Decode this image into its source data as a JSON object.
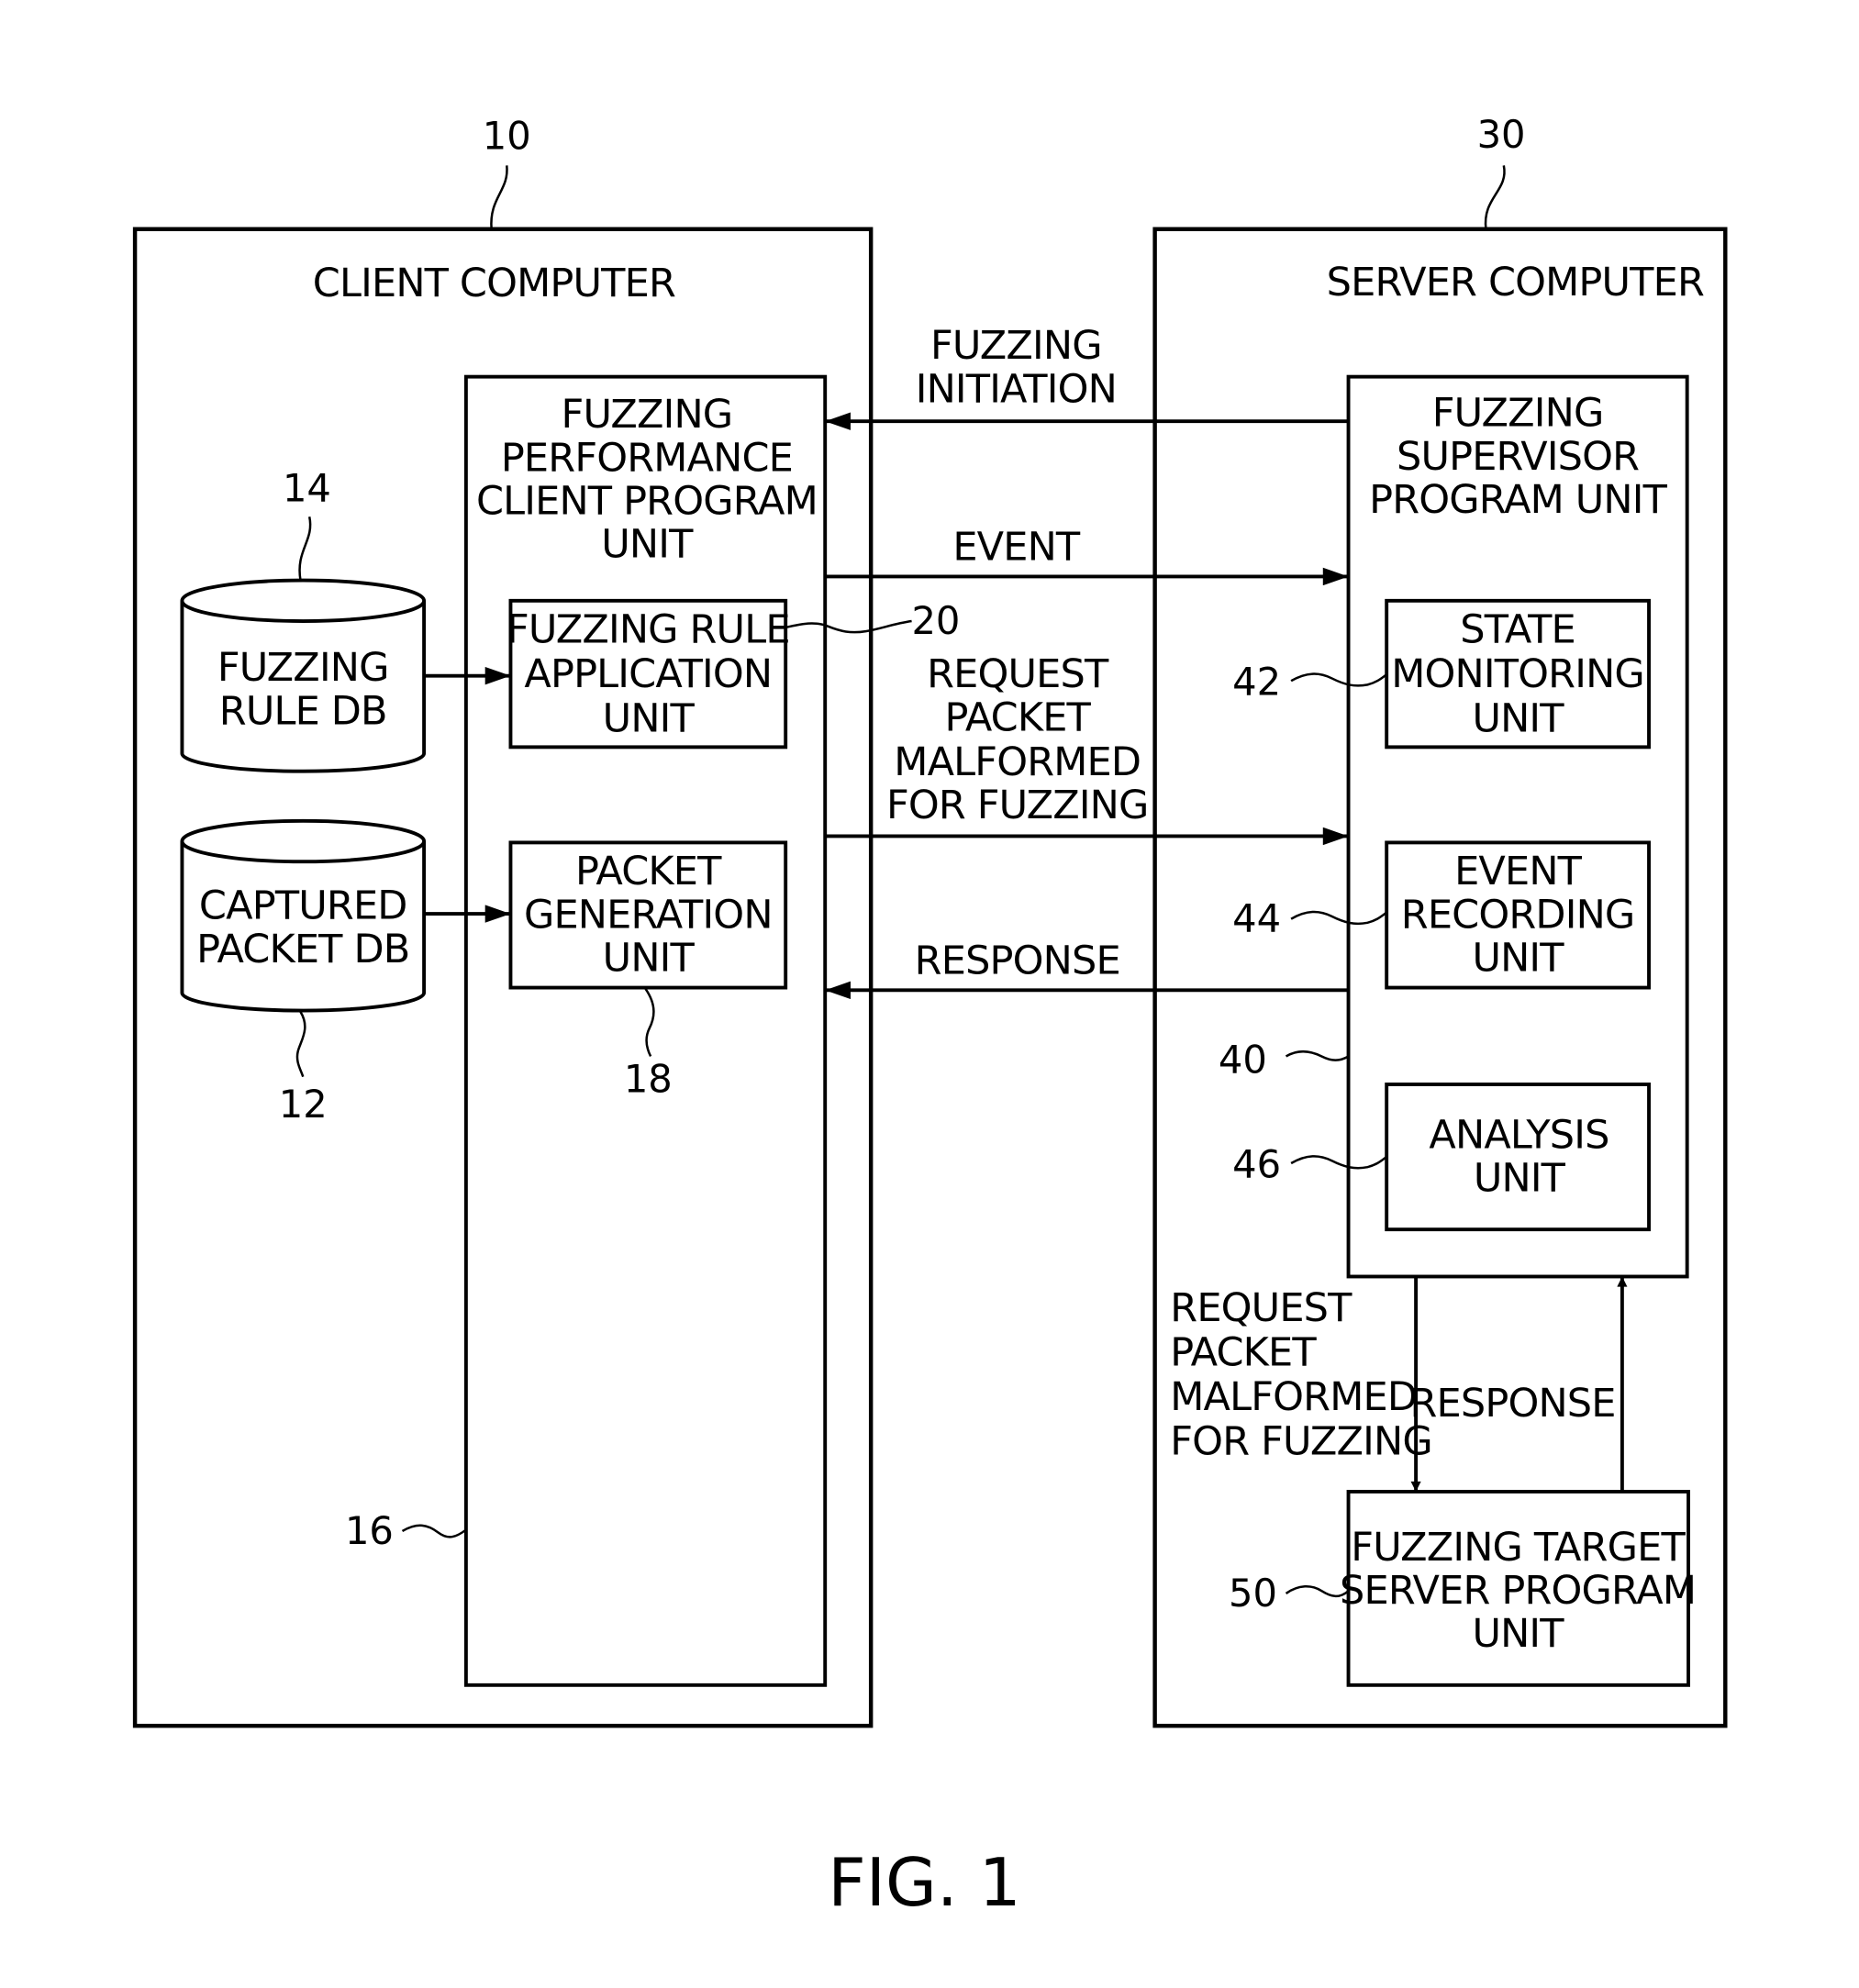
{
  "figure": {
    "caption": "FIG. 1",
    "client": {
      "ref": "10",
      "title": "CLIENT COMPUTER",
      "program_unit": {
        "ref": "16",
        "lines": [
          "FUZZING",
          "PERFORMANCE",
          "CLIENT PROGRAM",
          "UNIT"
        ]
      },
      "rule_application_unit": {
        "ref": "20",
        "lines": [
          "FUZZING RULE",
          "APPLICATION",
          "UNIT"
        ]
      },
      "packet_generation_unit": {
        "ref": "18",
        "lines": [
          "PACKET",
          "GENERATION",
          "UNIT"
        ]
      },
      "fuzzing_rule_db": {
        "ref": "14",
        "lines": [
          "FUZZING",
          "RULE DB"
        ]
      },
      "captured_packet_db": {
        "ref": "12",
        "lines": [
          "CAPTURED",
          "PACKET DB"
        ]
      }
    },
    "server": {
      "ref": "30",
      "title": "SERVER COMPUTER",
      "supervisor_unit": {
        "ref": "40",
        "lines": [
          "FUZZING",
          "SUPERVISOR",
          "PROGRAM UNIT"
        ]
      },
      "state_monitoring_unit": {
        "ref": "42",
        "lines": [
          "STATE",
          "MONITORING",
          "UNIT"
        ]
      },
      "event_recording_unit": {
        "ref": "44",
        "lines": [
          "EVENT",
          "RECORDING",
          "UNIT"
        ]
      },
      "analysis_unit": {
        "ref": "46",
        "lines": [
          "ANALYSIS",
          "UNIT"
        ]
      },
      "target_server_unit": {
        "ref": "50",
        "lines": [
          "FUZZING TARGET",
          "SERVER PROGRAM",
          "UNIT"
        ]
      }
    },
    "arrows": {
      "initiation": {
        "lines": [
          "FUZZING",
          "INITIATION"
        ],
        "direction": "server-to-client"
      },
      "event": {
        "lines": [
          "EVENT"
        ],
        "direction": "client-to-server"
      },
      "request": {
        "lines": [
          "REQUEST",
          "PACKET",
          "MALFORMED",
          "FOR FUZZING"
        ],
        "direction": "client-to-server"
      },
      "response": {
        "lines": [
          "RESPONSE"
        ],
        "direction": "server-to-client"
      },
      "target_request": {
        "lines": [
          "REQUEST",
          "PACKET",
          "MALFORMED",
          "FOR FUZZING"
        ],
        "direction": "supervisor-to-target"
      },
      "target_response": {
        "lines": [
          "RESPONSE"
        ],
        "direction": "target-to-supervisor"
      }
    }
  }
}
